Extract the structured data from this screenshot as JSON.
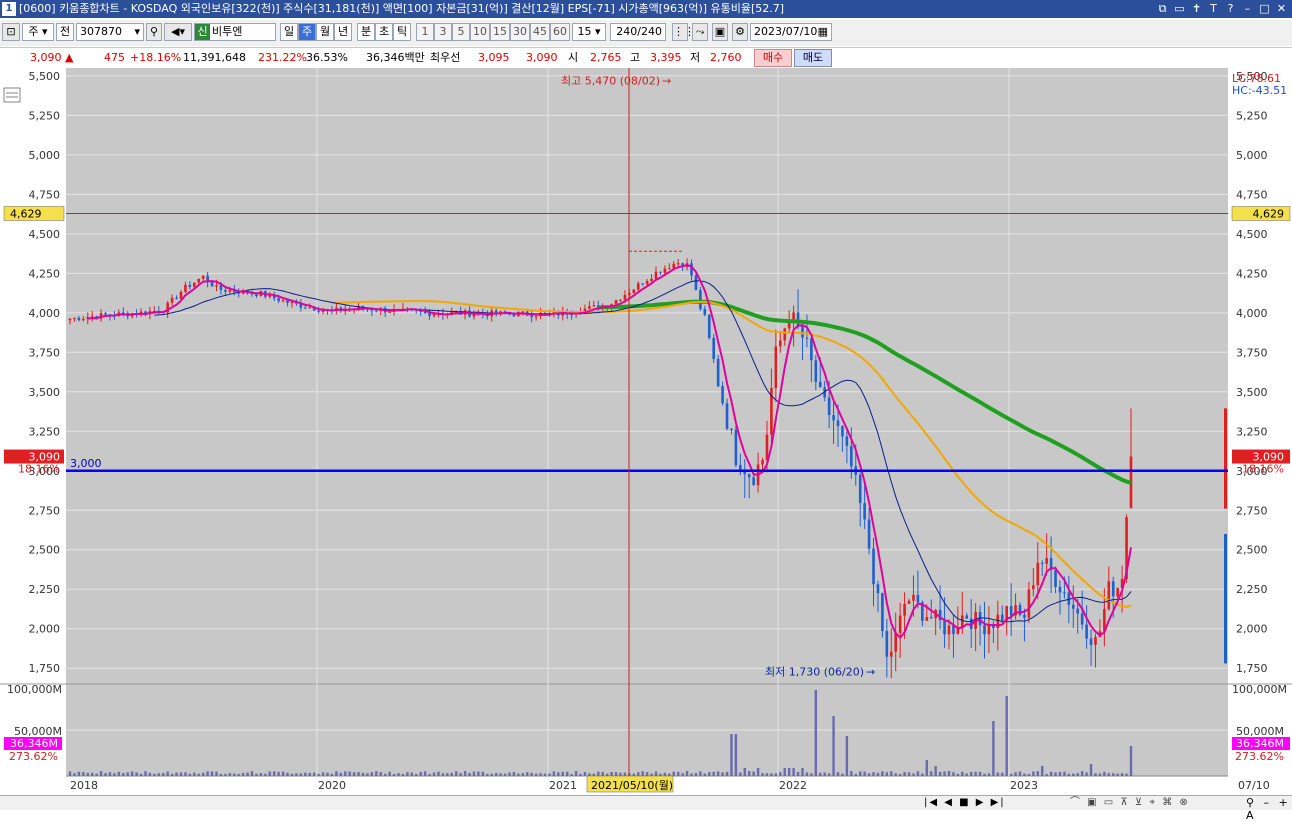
{
  "window": {
    "number": "1",
    "title": "[0600] 키움종합차트 - KOSDAQ 외국인보유[322(천)] 주식수[31,181(천)] 액면[100] 자본금[31(억)] 결산[12월] EPS[-71] 시가총액[963(억)] 유통비율[52.7]"
  },
  "toolbar": {
    "type_select": "주",
    "market_select": "전",
    "code": "307870",
    "badge": "신",
    "stock_name": "비투엔",
    "periods": [
      "일",
      "주",
      "월",
      "년",
      "분",
      "초",
      "틱"
    ],
    "active_period": "주",
    "intervals": [
      "1",
      "3",
      "5",
      "10",
      "15",
      "30",
      "45",
      "60"
    ],
    "interval_value": "15",
    "count": "240",
    "count_total": "/240",
    "date": "2023/07/10"
  },
  "info": {
    "price": "3,090",
    "arrow": "▲",
    "change": "475",
    "change_pct": "+18.16%",
    "volume": "11,391,648",
    "volume_ratio": "231.22%",
    "turnover": "36.53%",
    "amount": "36,346백만",
    "best_label": "최우선",
    "ask": "3,095",
    "bid": "3,090",
    "open_label": "시",
    "open": "2,765",
    "high_label": "고",
    "high": "3,395",
    "low_label": "저",
    "low": "2,760",
    "buy_label": "매수",
    "sell_label": "매도"
  },
  "chart": {
    "lc": "LC:78.61",
    "hc": "HC:-43.51",
    "price_ticks": [
      "5,500",
      "5,250",
      "5,000",
      "4,750",
      "4,500",
      "4,250",
      "4,000",
      "3,750",
      "3,500",
      "3,250",
      "3,000",
      "2,750",
      "2,500",
      "2,250",
      "2,000",
      "1,750"
    ],
    "crosshair_value": "4,629",
    "current_price": "3,090",
    "current_pct": "18.16%",
    "hline_label": "3,000",
    "max_label": "최고 5,470 (08/02)",
    "min_label": "최저 1,730 (06/20)",
    "volume_ticks": [
      "100,000M",
      "50,000M"
    ],
    "volume_current": "36,346M",
    "volume_pct": "273.62%",
    "x_labels": [
      "2018",
      "2020",
      "2021",
      "2022",
      "2023"
    ],
    "crosshair_date": "2021/05/10(월)",
    "right_date": "07/10",
    "colors": {
      "up": "#e02020",
      "down": "#1f5fd0",
      "ma5": "#e000a0",
      "ma20": "#0a1f8a",
      "ma60": "#f2a800",
      "ma120": "#20a020",
      "hline": "#0000ff",
      "bg": "#c8c8c8"
    }
  },
  "chart_data": {
    "type": "candlestick",
    "title": "",
    "xlabel": "",
    "ylabel": "",
    "ylim": [
      1650,
      5550
    ],
    "x_labels": [
      "2018",
      "2020",
      "2021",
      "2022",
      "2023"
    ],
    "hline": 3000,
    "highest": {
      "value": 5470,
      "date": "08/02"
    },
    "lowest": {
      "value": 1730,
      "date": "06/20"
    },
    "last": {
      "open": 2765,
      "high": 3395,
      "low": 2760,
      "close": 3090
    }
  }
}
